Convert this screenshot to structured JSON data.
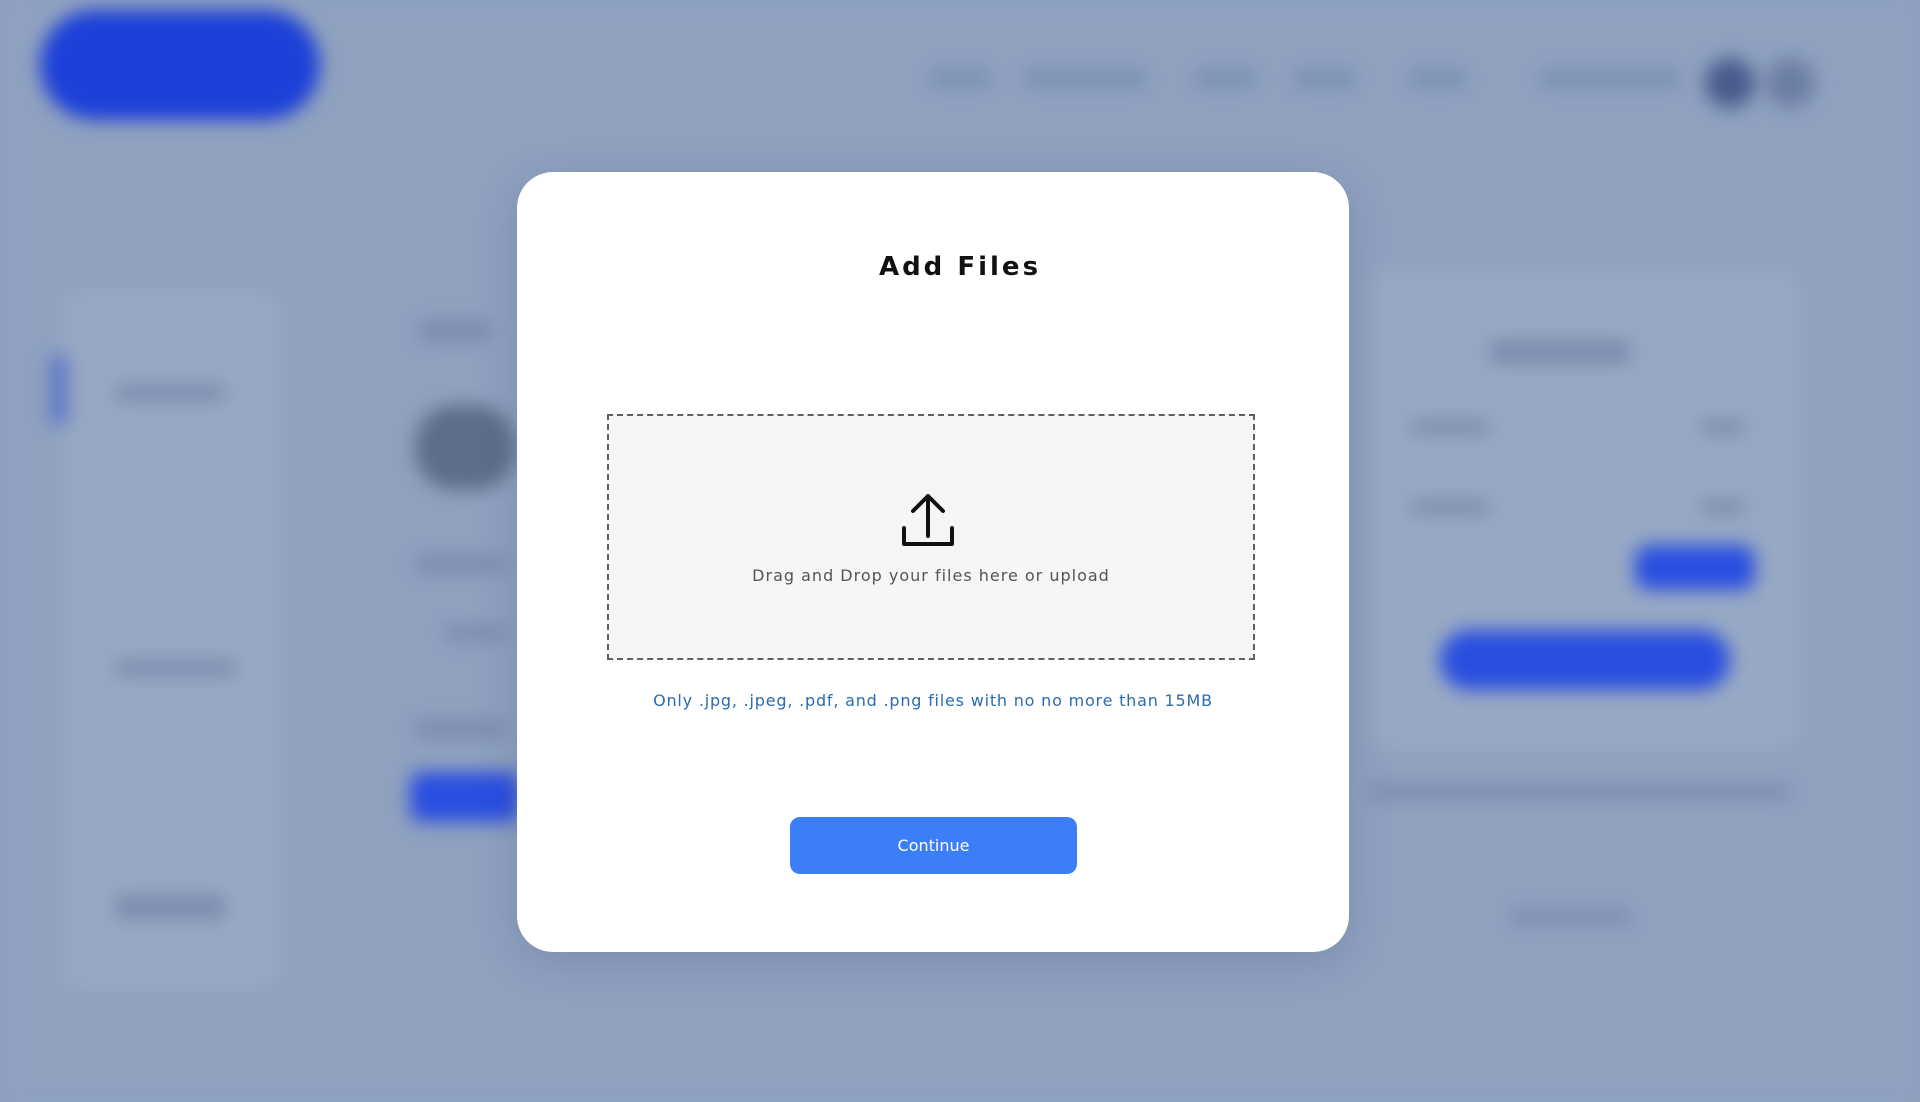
{
  "modal": {
    "title": "Add Files",
    "dropzone_text": "Drag and Drop your files here or upload",
    "hint_text": "Only .jpg, .jpeg, .pdf, and .png files with no no more than 15MB",
    "continue_label": "Continue",
    "upload_icon": "upload-icon"
  },
  "colors": {
    "overlay_background": "#8fa1bf",
    "modal_background": "#ffffff",
    "dropzone_background": "#f6f6f6",
    "hint_text": "#2b6cb0",
    "primary_button": "#3b7ef8"
  }
}
